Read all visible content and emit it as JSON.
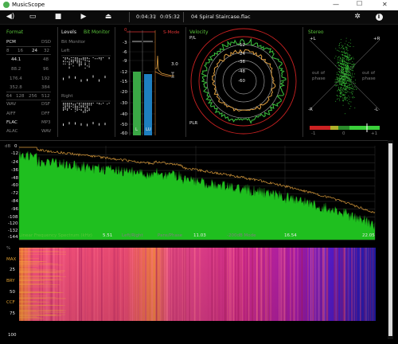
{
  "window": {
    "title": "MusicScope",
    "min": "—",
    "max": "☐",
    "close": "✕"
  },
  "toolbar": {
    "time_elapsed": "0:04:31",
    "time_total": "0:05:32",
    "filename": "04 Spiral Staircase.flac"
  },
  "format": {
    "title": "Format",
    "pcm": "PCM",
    "dsd": "DSD",
    "bits": [
      "8",
      "16",
      "24",
      "32"
    ],
    "rates_left": [
      "44.1",
      "88.2",
      "176.4",
      "352.8"
    ],
    "rates_right": [
      "48",
      "96",
      "192",
      "384"
    ],
    "dsd_rates": [
      "64",
      "128",
      "256",
      "512"
    ],
    "containers_left": [
      "WAV",
      "AIFF",
      "FLAC",
      "ALAC"
    ],
    "containers_right": [
      "DSF",
      "DFF",
      "MP3",
      "WAV"
    ]
  },
  "levels": {
    "title": "Levels",
    "bitmonitor": "Bit Monitor",
    "bitmonitor2": "Bit Monitor",
    "left": "Left",
    "right": "Right",
    "scale": [
      "0",
      "-3",
      "-6",
      "-9",
      "-12",
      "-15",
      "-20",
      "-30",
      "-40",
      "-50",
      "-60"
    ],
    "l_label": "L",
    "lu_label": "LU",
    "smode": "S-Mode",
    "peak_value": "3.0"
  },
  "velocity": {
    "title": "Velocity",
    "pl": "P/L",
    "plr": "PLR",
    "rings": [
      "-12",
      "-24",
      "-36",
      "-48",
      "-60"
    ]
  },
  "stereo": {
    "title": "Stereo",
    "plus_l": "+L",
    "plus_r": "+R",
    "minus_l": "-R",
    "minus_r": "-L",
    "out_of_phase": "out of phase",
    "corr": [
      "-1",
      "0",
      "+1"
    ]
  },
  "spectrum": {
    "db_label": "dB",
    "y_ticks": [
      "0",
      "-12",
      "-24",
      "-36",
      "-48",
      "-60",
      "-72",
      "-84",
      "-96",
      "-108",
      "-120",
      "-132",
      "-144"
    ],
    "bottom_label": "Linear Frequency Spectrum (kHz)",
    "x_ticks": [
      "5.51",
      "Left/Right",
      "Pans/Phase",
      "11.03",
      "-200dB Mode",
      "16.54",
      "22.05"
    ]
  },
  "spectrogram": {
    "y_labels": [
      "%",
      "MAX",
      "25",
      "BRY",
      "50",
      "CCF",
      "75",
      "100"
    ]
  }
}
